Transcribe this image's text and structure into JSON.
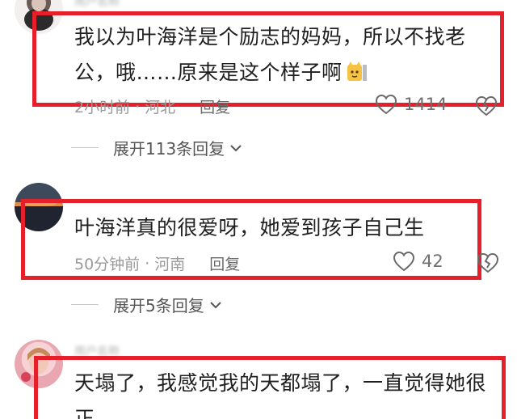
{
  "comments": [
    {
      "text_line1": "我以为叶海洋是个励志的妈妈，所以不找老",
      "text_line2": "公，哦……原来是这个样子啊",
      "time": "2小时前",
      "location": "河北",
      "reply": "回复",
      "likes": "1414",
      "expand": "展开113条回复"
    },
    {
      "text_line1": "叶海洋真的很爱呀，她爱到孩子自己生",
      "time": "50分钟前",
      "location": "河南",
      "reply": "回复",
      "likes": "42",
      "expand": "展开5条回复"
    },
    {
      "text_line1": "天塌了，我感觉我的天都塌了，一直觉得她很",
      "text_line2": "正"
    }
  ],
  "colors": {
    "highlight": "#e5202b",
    "meta": "#9a9a9a"
  },
  "icons": [
    "heart-icon",
    "broken-heart-icon",
    "chevron-down-icon",
    "cat-emoji-icon"
  ]
}
